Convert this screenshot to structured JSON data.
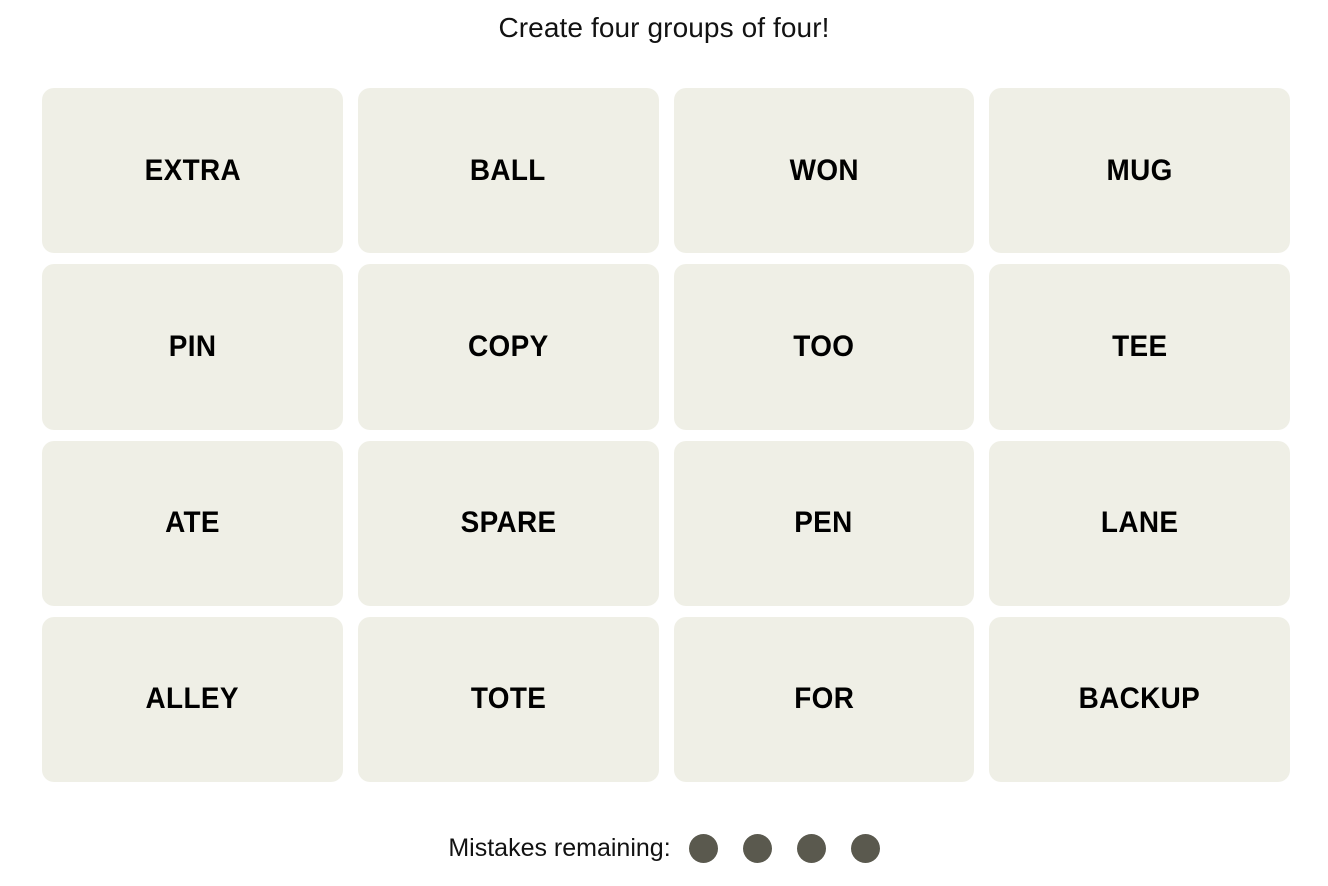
{
  "game": {
    "instruction": "Create four groups of four!",
    "tile_bg_color": "#EFEFE6",
    "tile_text_color": "#000000",
    "page_bg_color": "#FFFFFF",
    "mistake_dot_color": "#5A594E"
  },
  "board": {
    "rows": 4,
    "columns": 4,
    "tiles": [
      {
        "label": "EXTRA",
        "row": 1,
        "col": 1,
        "selected": false
      },
      {
        "label": "BALL",
        "row": 1,
        "col": 2,
        "selected": false
      },
      {
        "label": "WON",
        "row": 1,
        "col": 3,
        "selected": false
      },
      {
        "label": "MUG",
        "row": 1,
        "col": 4,
        "selected": false
      },
      {
        "label": "PIN",
        "row": 2,
        "col": 1,
        "selected": false
      },
      {
        "label": "COPY",
        "row": 2,
        "col": 2,
        "selected": false
      },
      {
        "label": "TOO",
        "row": 2,
        "col": 3,
        "selected": false
      },
      {
        "label": "TEE",
        "row": 2,
        "col": 4,
        "selected": false
      },
      {
        "label": "ATE",
        "row": 3,
        "col": 1,
        "selected": false
      },
      {
        "label": "SPARE",
        "row": 3,
        "col": 2,
        "selected": false
      },
      {
        "label": "PEN",
        "row": 3,
        "col": 3,
        "selected": false
      },
      {
        "label": "LANE",
        "row": 3,
        "col": 4,
        "selected": false
      },
      {
        "label": "ALLEY",
        "row": 4,
        "col": 1,
        "selected": false
      },
      {
        "label": "TOTE",
        "row": 4,
        "col": 2,
        "selected": false
      },
      {
        "label": "FOR",
        "row": 4,
        "col": 3,
        "selected": false
      },
      {
        "label": "BACKUP",
        "row": 4,
        "col": 4,
        "selected": false
      }
    ]
  },
  "footer": {
    "mistakes_label": "Mistakes remaining:",
    "mistakes_remaining": 4,
    "dots": [
      1,
      2,
      3,
      4
    ]
  }
}
